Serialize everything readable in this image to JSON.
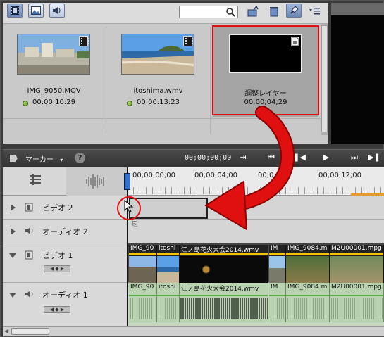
{
  "bin": {
    "toolbar": {
      "view_video_icon": "film-view-icon",
      "view_image_icon": "image-view-icon",
      "view_audio_icon": "speaker-view-icon",
      "search_value": "",
      "search_icon": "magnifier-icon",
      "tools": [
        "import-icon",
        "trash-icon",
        "pin-icon",
        "list-menu-icon"
      ]
    },
    "clips": [
      {
        "name": "IMG_9050.MOV",
        "duration": "00:00:10:29",
        "status": "online",
        "type_icon": "film-icon"
      },
      {
        "name": "itoshima.wmv",
        "duration": "00:00:13:23",
        "status": "online",
        "type_icon": "film-icon"
      },
      {
        "name": "調整レイヤー",
        "duration": "00;00;04;29",
        "type_icon": "adjustment-layer-icon",
        "selected": true
      }
    ]
  },
  "timeline": {
    "toolbar": {
      "marker_label": "マーカー",
      "timecode": "00;00;00;00",
      "help": "?",
      "transport": [
        "mark-in-icon",
        "go-start-icon",
        "step-back-icon",
        "play-icon",
        "go-end-icon"
      ]
    },
    "ruler": {
      "labels": [
        "00;00;00;00",
        "00;00;04;00",
        "00;0",
        "00;00;12;00"
      ]
    },
    "tracks": [
      {
        "name": "ビデオ 2",
        "kind": "video",
        "expanded": false
      },
      {
        "name": "オーディオ 2",
        "kind": "audio",
        "expanded": false
      },
      {
        "name": "ビデオ 1",
        "kind": "video",
        "expanded": true
      },
      {
        "name": "オーディオ 1",
        "kind": "audio",
        "expanded": true
      }
    ],
    "video1_clips": [
      "IMG_90",
      "itoshi",
      "江ノ島花火大会2014.wmv",
      "IM",
      "IMG_9084.m",
      "M2U00001.mpg"
    ],
    "audio1_clips": [
      "IMG_90",
      "itoshi",
      "江ノ島花火大会2014.wmv",
      "IM",
      "IMG_9084.m",
      "M2U00001.mpg"
    ],
    "drag_cursor_label": "⎘"
  },
  "annotation": {
    "highlight_color": "#e01010",
    "arrow_color": "#e01010"
  }
}
